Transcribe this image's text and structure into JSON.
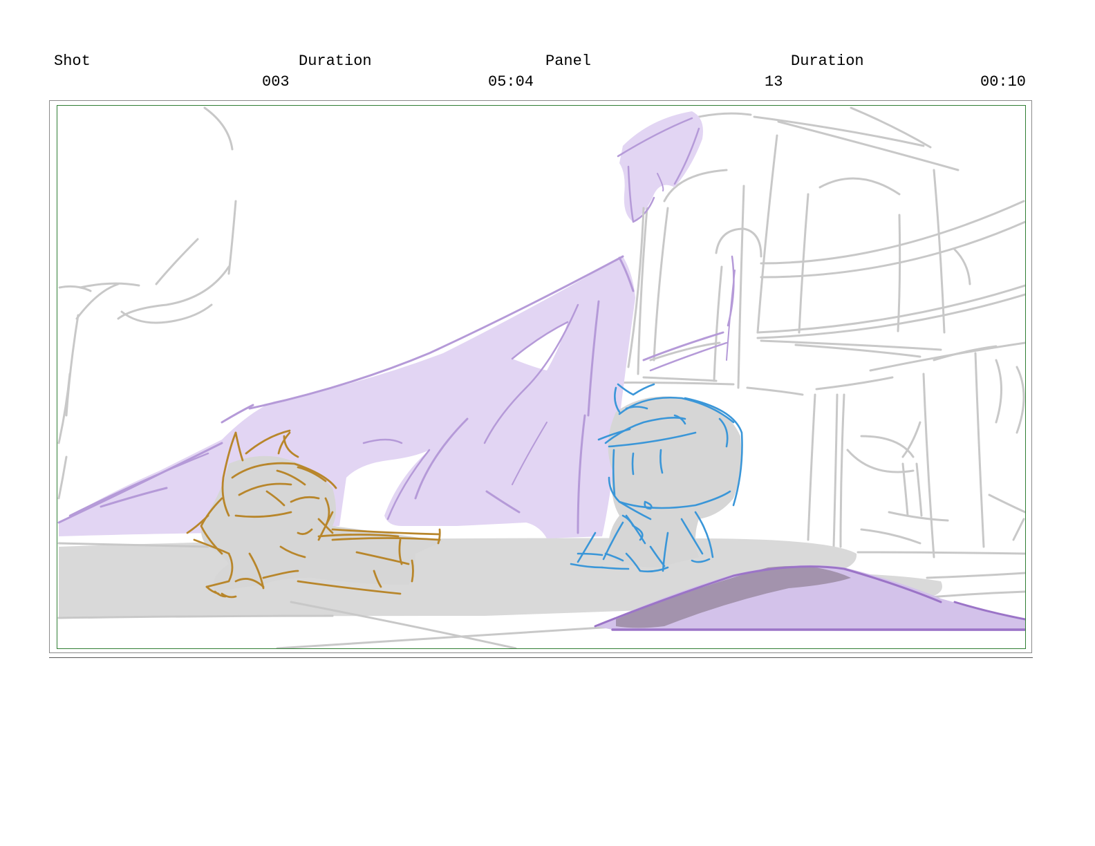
{
  "header": {
    "shot_label": "Shot",
    "shot_duration_label": "Duration",
    "panel_label": "Panel",
    "panel_duration_label": "Duration",
    "shot_value": "003",
    "shot_duration_value": "05:04",
    "panel_value": "13",
    "panel_duration_value": "00:10"
  },
  "colors": {
    "frame_border": "#8a8a8a",
    "safe_area_border": "#2e7d32",
    "sketch_gray": "#c8c8c8",
    "ground_gray": "#d9d9d9",
    "lavender_fill": "#e2d5f3",
    "purple_stroke": "#b59ad8",
    "dark_purple": "#9b74c7",
    "cat_orange": "#b8862b",
    "kid_blue": "#3a96d8"
  }
}
